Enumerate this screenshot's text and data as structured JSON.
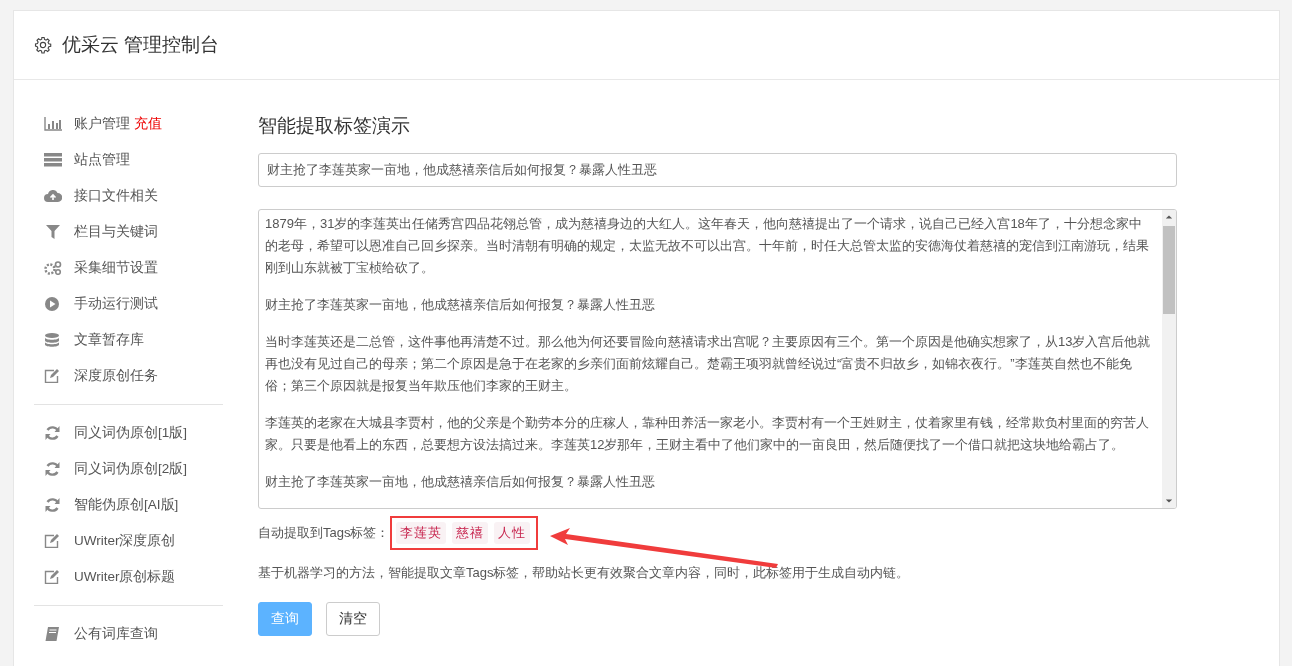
{
  "header": {
    "title": "优采云 管理控制台"
  },
  "sidebar": {
    "groups": [
      {
        "items": [
          {
            "kind": "bar-chart",
            "label": "账户管理",
            "badge": "充值"
          },
          {
            "kind": "server",
            "label": "站点管理"
          },
          {
            "kind": "cloud-upload",
            "label": "接口文件相关"
          },
          {
            "kind": "filter",
            "label": "栏目与关键词"
          },
          {
            "kind": "gears",
            "label": "采集细节设置"
          },
          {
            "kind": "play",
            "label": "手动运行测试"
          },
          {
            "kind": "database",
            "label": "文章暂存库"
          },
          {
            "kind": "edit",
            "label": "深度原创任务"
          }
        ]
      },
      {
        "items": [
          {
            "kind": "refresh",
            "label": "同义词伪原创[1版]"
          },
          {
            "kind": "refresh",
            "label": "同义词伪原创[2版]"
          },
          {
            "kind": "refresh",
            "label": "智能伪原创[AI版]"
          },
          {
            "kind": "edit",
            "label": "UWriter深度原创"
          },
          {
            "kind": "edit",
            "label": "UWriter原创标题"
          }
        ]
      },
      {
        "items": [
          {
            "kind": "book",
            "label": "公有词库查询"
          }
        ]
      }
    ]
  },
  "main": {
    "title": "智能提取标签演示",
    "title_field": {
      "value": "财主抢了李莲英家一亩地，他成慈禧亲信后如何报复？暴露人性丑恶"
    },
    "article_box": {
      "paragraphs": [
        "1879年，31岁的李莲英出任储秀宫四品花翎总管，成为慈禧身边的大红人。这年春天，他向慈禧提出了一个请求，说自己已经入宫18年了，十分想念家中的老母，希望可以恩准自己回乡探亲。当时清朝有明确的规定，太监无故不可以出宫。十年前，时任大总管太监的安德海仗着慈禧的宠信到江南游玩，结果刚到山东就被丁宝桢给砍了。",
        "财主抢了李莲英家一亩地，他成慈禧亲信后如何报复？暴露人性丑恶",
        "当时李莲英还是二总管，这件事他再清楚不过。那么他为何还要冒险向慈禧请求出宫呢？主要原因有三个。第一个原因是他确实想家了，从13岁入宫后他就再也没有见过自己的母亲；第二个原因是急于在老家的乡亲们面前炫耀自己。楚霸王项羽就曾经说过“富贵不归故乡，如锦衣夜行。”李莲英自然也不能免俗；第三个原因就是报复当年欺压他们李家的王财主。",
        "李莲英的老家在大城县李贾村，他的父亲是个勤劳本分的庄稼人，靠种田养活一家老小。李贾村有一个王姓财主，仗着家里有钱，经常欺负村里面的穷苦人家。只要是他看上的东西，总要想方设法搞过来。李莲英12岁那年，王财主看中了他们家中的一亩良田，然后随便找了一个借口就把这块地给霸占了。",
        "财主抢了李莲英家一亩地，他成慈禧亲信后如何报复？暴露人性丑恶"
      ]
    },
    "tags_label": "自动提取到Tags标签：",
    "tags": [
      "李莲英",
      "慈禧",
      "人性"
    ],
    "description": "基于机器学习的方法，智能提取文章Tags标签，帮助站长更有效聚合文章内容，同时，此标签用于生成自动内链。",
    "buttons": [
      {
        "label": "查询",
        "kind": "primary"
      },
      {
        "label": "清空",
        "kind": "default"
      }
    ]
  }
}
